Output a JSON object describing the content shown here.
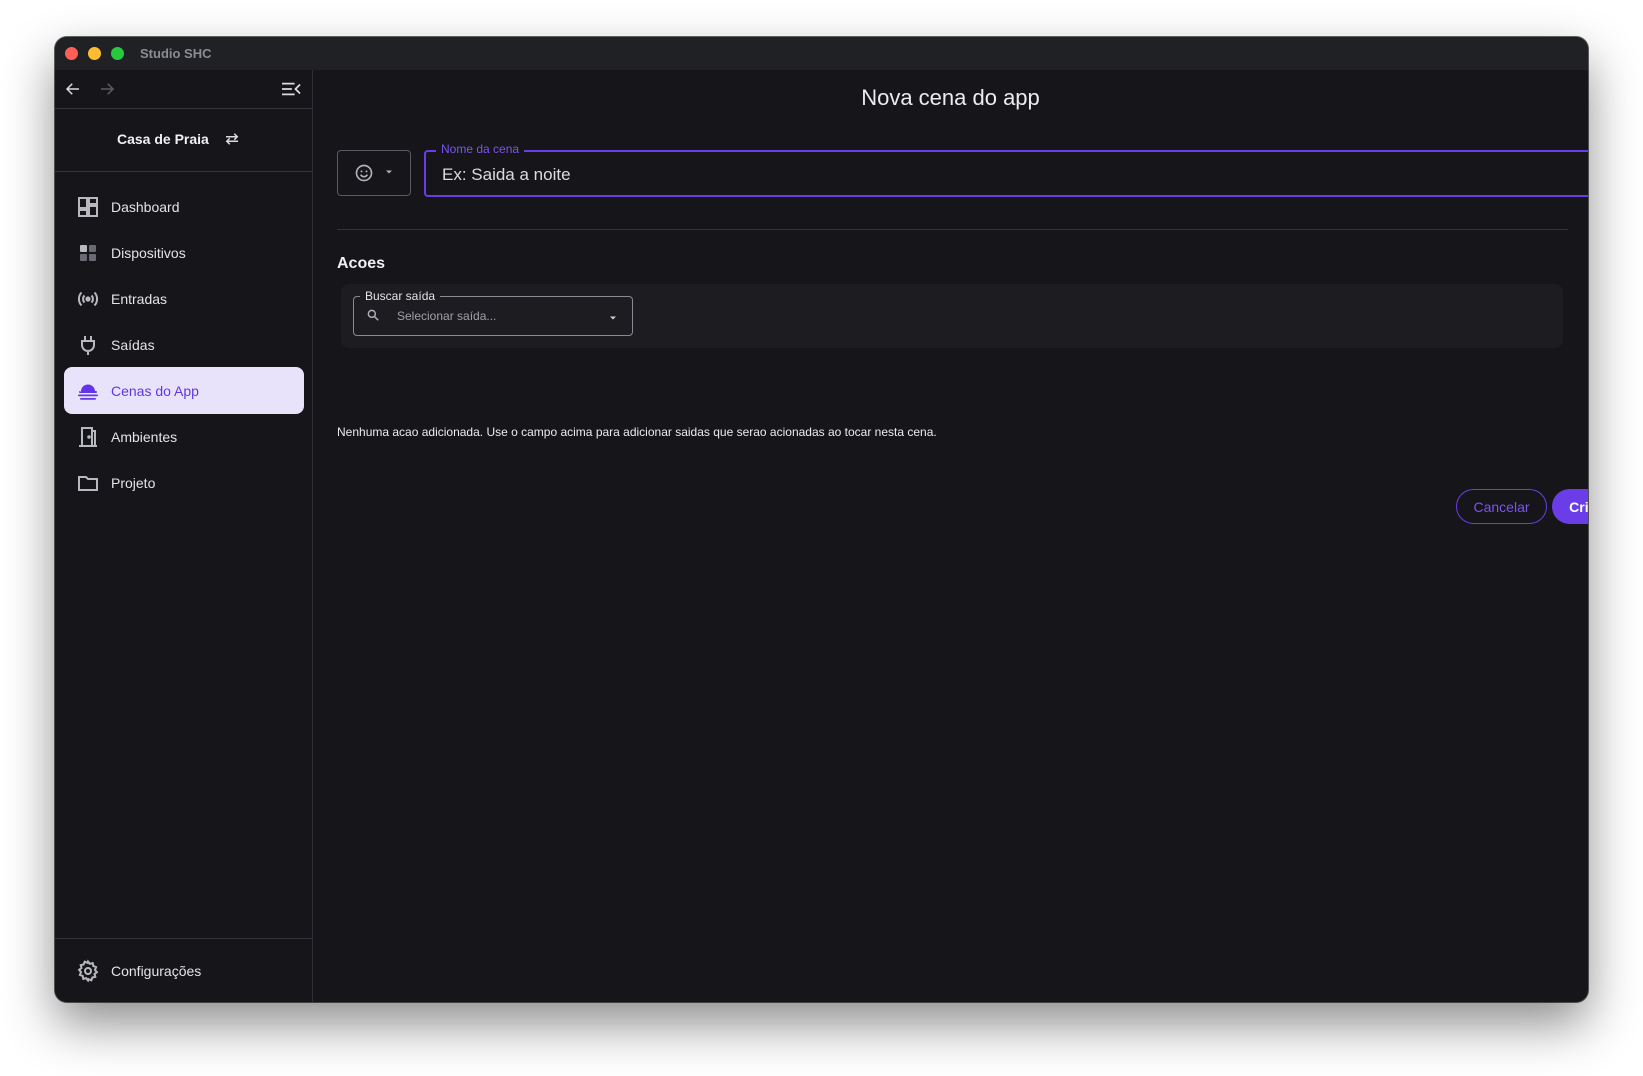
{
  "window": {
    "title": "Studio SHC"
  },
  "sidebar": {
    "project_name": "Casa de Praia",
    "items": [
      {
        "label": "Dashboard",
        "icon": "dashboard-icon",
        "active": false
      },
      {
        "label": "Dispositivos",
        "icon": "devices-icon",
        "active": false
      },
      {
        "label": "Entradas",
        "icon": "broadcast-icon",
        "active": false
      },
      {
        "label": "Saídas",
        "icon": "plug-icon",
        "active": false
      },
      {
        "label": "Cenas do App",
        "icon": "scene-cloud-icon",
        "active": true
      },
      {
        "label": "Ambientes",
        "icon": "door-icon",
        "active": false
      },
      {
        "label": "Projeto",
        "icon": "folder-icon",
        "active": false
      }
    ],
    "footer_label": "Configurações"
  },
  "main": {
    "title": "Nova cena do app",
    "name_field": {
      "label": "Nome da cena",
      "placeholder": "Ex: Saida a noite",
      "value": ""
    },
    "section_title": "Acoes",
    "search": {
      "label": "Buscar saída",
      "placeholder": "Selecionar saída..."
    },
    "empty_message": "Nenhuma acao adicionada. Use o campo acima para adicionar saidas que serao acionadas ao tocar nesta cena.",
    "cancel_label": "Cancelar",
    "create_label": "Criar"
  },
  "colors": {
    "accent": "#6a3de8",
    "background": "#15151a",
    "active_item_bg": "#e8e3fb"
  }
}
